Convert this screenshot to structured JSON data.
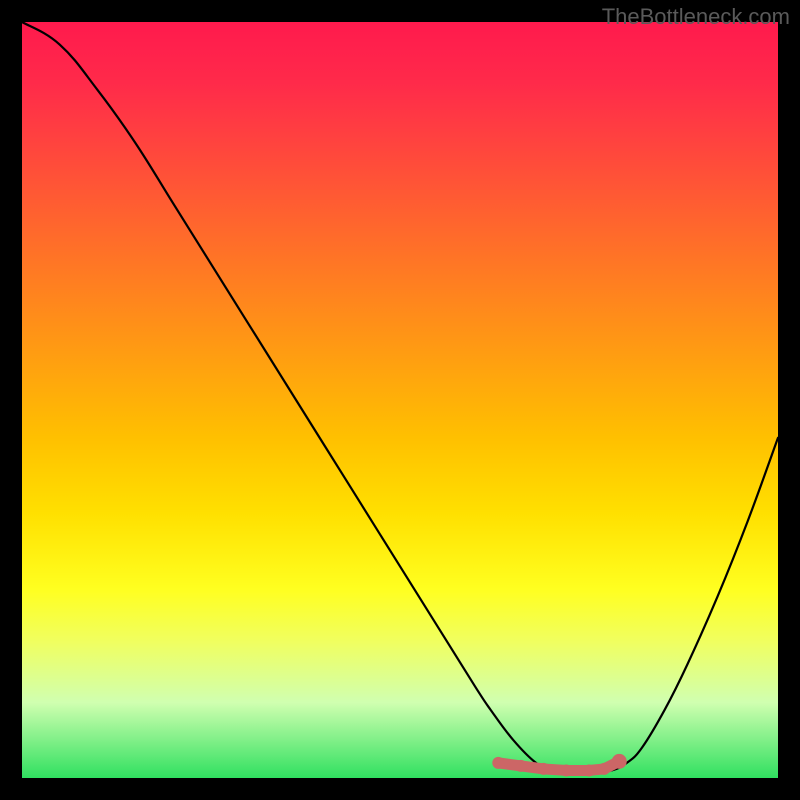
{
  "watermark": "TheBottleneck.com",
  "chart_data": {
    "type": "line",
    "title": "",
    "xlabel": "",
    "ylabel": "",
    "xlim": [
      0,
      100
    ],
    "ylim": [
      0,
      100
    ],
    "series": [
      {
        "name": "bottleneck-curve",
        "x": [
          0,
          5,
          10,
          15,
          20,
          25,
          30,
          35,
          40,
          45,
          50,
          55,
          60,
          62,
          65,
          68,
          70,
          72,
          74,
          76,
          78,
          80,
          82,
          85,
          88,
          92,
          96,
          100
        ],
        "values": [
          100,
          97,
          91,
          84,
          76,
          68,
          60,
          52,
          44,
          36,
          28,
          20,
          12,
          9,
          5,
          2,
          1.2,
          1,
          1,
          1,
          1,
          2,
          4,
          9,
          15,
          24,
          34,
          45
        ]
      }
    ],
    "markers": {
      "name": "optimal-range",
      "color": "#cc6666",
      "x": [
        63,
        66,
        69,
        72,
        75,
        77,
        79
      ],
      "values": [
        2.0,
        1.6,
        1.2,
        1.0,
        1.0,
        1.2,
        2.2
      ]
    }
  }
}
